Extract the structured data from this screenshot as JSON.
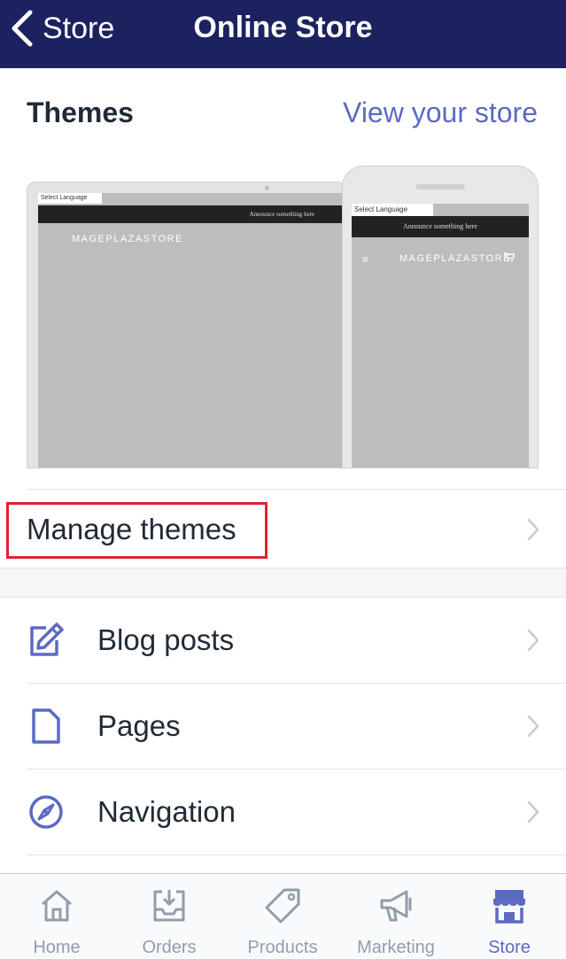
{
  "nav": {
    "back_label": "Store",
    "title": "Online Store"
  },
  "themes": {
    "heading": "Themes",
    "view_store": "View your store",
    "preview": {
      "select_language": "Select Language",
      "announcement": "Announce something here",
      "store_name": "MAGEPLAZASTORE"
    },
    "manage_label": "Manage themes"
  },
  "list": {
    "items": [
      {
        "label": "Blog posts",
        "icon": "edit-icon"
      },
      {
        "label": "Pages",
        "icon": "page-icon"
      },
      {
        "label": "Navigation",
        "icon": "compass-icon"
      }
    ]
  },
  "tabs": [
    {
      "label": "Home",
      "icon": "home-icon",
      "active": false
    },
    {
      "label": "Orders",
      "icon": "orders-icon",
      "active": false
    },
    {
      "label": "Products",
      "icon": "tag-icon",
      "active": false
    },
    {
      "label": "Marketing",
      "icon": "megaphone-icon",
      "active": false
    },
    {
      "label": "Store",
      "icon": "store-icon",
      "active": true
    }
  ],
  "colors": {
    "nav_bg": "#1c2260",
    "accent": "#5c6ac4",
    "highlight": "#e0232e",
    "inactive": "#919eab"
  }
}
